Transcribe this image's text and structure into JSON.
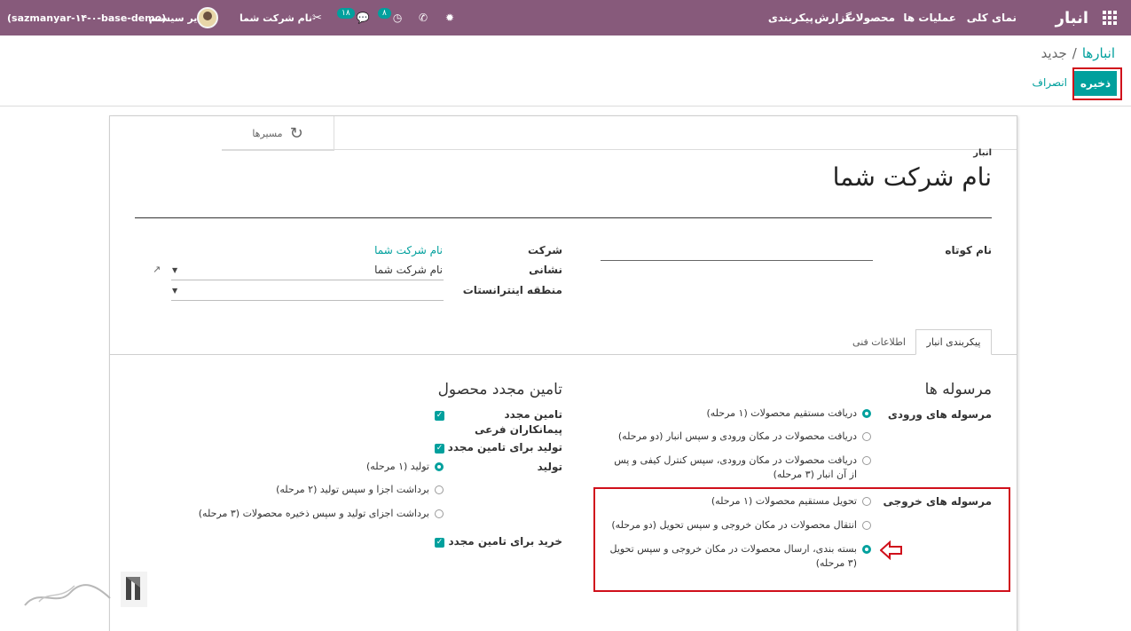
{
  "navbar": {
    "brand": "انبار",
    "menu": [
      "نمای کلی",
      "عملیات ها",
      "محصولات",
      "گزارش",
      "پیکربندی"
    ],
    "company": "نام شرکت شما",
    "user": "مدیر سیستم",
    "db": "(sazmanyar-۱۴-۰-base-demo)",
    "chat_count": "۱۸",
    "activity_count": "۸"
  },
  "breadcrumb": {
    "parent": "انبارها",
    "separator": "/",
    "current": "جدید"
  },
  "actions": {
    "save_label": "ذخیره",
    "discard_label": "انصراف"
  },
  "button_box": {
    "routes_label": "مسیرها"
  },
  "form": {
    "overline": "انبار",
    "name": "نام شرکت شما",
    "short_name_label": "نام کوتاه",
    "company_label": "شرکت",
    "company_value": "نام شرکت شما",
    "address_label": "نشانی",
    "address_value": "نام شرکت شما",
    "region_label": "منطقه اینترانستات"
  },
  "tabs": {
    "config": "پیکربندی انبار",
    "tech": "اطلاعات فنی"
  },
  "shipments": {
    "title": "مرسوله ها",
    "incoming_label": "مرسوله های ورودی",
    "incoming_options": [
      {
        "label": "دریافت مستقیم محصولات (۱ مرحله)",
        "selected": true
      },
      {
        "label": "دریافت محصولات در مکان ورودی و سپس انبار (دو مرحله)",
        "selected": false
      },
      {
        "label": "دریافت محصولات در مکان ورودی، سپس کنترل کیفی و پس از آن انبار (۳ مرحله)",
        "selected": false
      }
    ],
    "outgoing_label": "مرسوله های خروجی",
    "outgoing_options": [
      {
        "label": "تحویل مستقیم محصولات (۱ مرحله)",
        "selected": false
      },
      {
        "label": "انتقال محصولات در مکان خروجی و سپس تحویل (دو مرحله)",
        "selected": false
      },
      {
        "label": "بسته بندی، ارسال محصولات در مکان خروجی و سپس تحویل (۳ مرحله)",
        "selected": true
      }
    ]
  },
  "resupply": {
    "title": "تامین مجدد محصول",
    "subcontract_label": "تامین مجدد پیمانکاران فرعی",
    "subcontract_checked": true,
    "manufacture_resupply_label": "تولید برای تامین مجدد",
    "manufacture_resupply_checked": true,
    "manufacture_label": "تولید",
    "manufacture_options": [
      {
        "label": "تولید (۱ مرحله)",
        "selected": true
      },
      {
        "label": "برداشت اجزا و سپس تولید (۲ مرحله)",
        "selected": false
      },
      {
        "label": "برداشت اجزای تولید و سپس ذخیره محصولات (۳ مرحله)",
        "selected": false
      }
    ],
    "buy_label": "خرید برای تامین مجدد",
    "buy_checked": true
  },
  "colors": {
    "navbar": "#875a7b",
    "primary": "#00a09d",
    "highlight": "#d0101b"
  }
}
